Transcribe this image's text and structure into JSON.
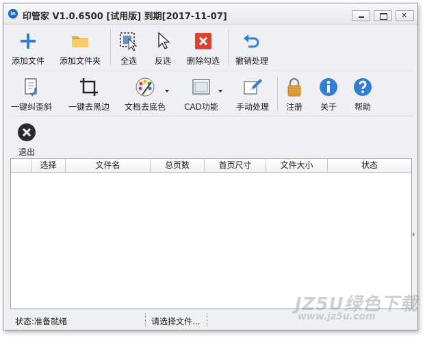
{
  "window": {
    "title": "印管家 V1.0.6500 [试用版] 到期[2017-11-07]",
    "app_icon_text": "in"
  },
  "toolbar": {
    "row1": [
      {
        "id": "add-file",
        "label": "添加文件",
        "icon": "plus-icon"
      },
      {
        "id": "add-folder",
        "label": "添加文件夹",
        "icon": "folder-icon"
      },
      {
        "id": "select-all",
        "label": "全选",
        "icon": "select-all-icon"
      },
      {
        "id": "invert-selection",
        "label": "反选",
        "icon": "cursor-icon"
      },
      {
        "id": "delete-checked",
        "label": "删除勾选",
        "icon": "delete-x-icon"
      },
      {
        "id": "undo",
        "label": "撤销处理",
        "icon": "undo-arrow-icon"
      }
    ],
    "row2": [
      {
        "id": "deskew",
        "label": "一键纠歪斜",
        "icon": "rotate-doc-icon"
      },
      {
        "id": "remove-black-border",
        "label": "一键去黑边",
        "icon": "crop-icon"
      },
      {
        "id": "remove-background",
        "label": "文档去底色",
        "icon": "palette-icon"
      },
      {
        "id": "cad",
        "label": "CAD功能",
        "icon": "cad-window-icon"
      },
      {
        "id": "manual",
        "label": "手动处理",
        "icon": "pencil-icon"
      },
      {
        "id": "register",
        "label": "注册",
        "icon": "lock-icon"
      },
      {
        "id": "about",
        "label": "关于",
        "icon": "info-icon"
      },
      {
        "id": "help",
        "label": "帮助",
        "icon": "help-icon"
      }
    ],
    "row3": [
      {
        "id": "exit",
        "label": "退出",
        "icon": "exit-icon"
      }
    ]
  },
  "table": {
    "columns": [
      "",
      "选择",
      "文件名",
      "总页数",
      "首页尺寸",
      "文件大小",
      "状态"
    ],
    "rows": []
  },
  "status": {
    "left": "状态:准备就绪",
    "middle": "请选择文件..."
  },
  "watermark": {
    "main": "JZ5U绿色下载",
    "sub": "www.jz5u.com"
  },
  "colors": {
    "accent_blue": "#2f7fd6",
    "delete_red": "#d9432f",
    "folder_yellow": "#f3c15a"
  }
}
